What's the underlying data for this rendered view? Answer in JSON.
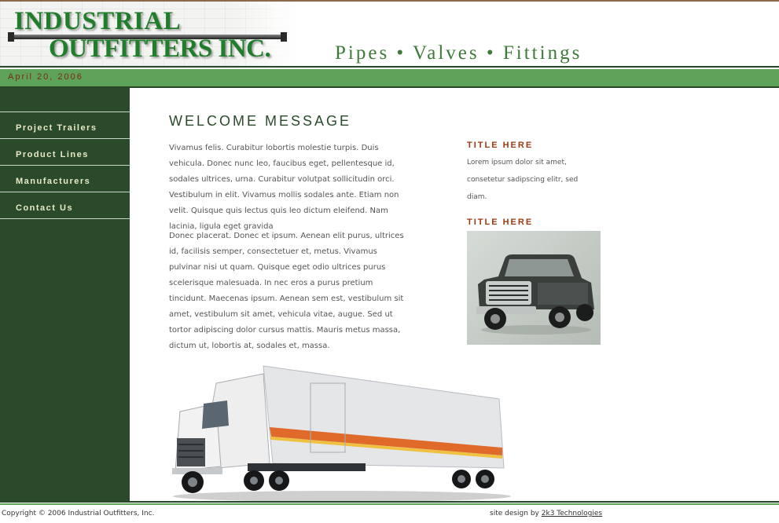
{
  "header": {
    "logo_line1": "INDUSTRIAL",
    "logo_line2": "OUTFITTERS INC.",
    "tagline": "Pipes • Valves • Fittings"
  },
  "date": "April 20, 2006",
  "nav": {
    "items": [
      {
        "label": "Project Trailers"
      },
      {
        "label": "Product Lines"
      },
      {
        "label": "Manufacturers"
      },
      {
        "label": "Contact Us"
      }
    ]
  },
  "main": {
    "heading": "WELCOME MESSAGE",
    "paragraphs": [
      "Vivamus felis. Curabitur lobortis molestie turpis. Duis vehicula. Donec nunc leo, faucibus eget, pellentesque id, sodales ultrices, urna. Curabitur volutpat sollicitudin orci. Vestibulum in elit. Vivamus mollis sodales ante. Etiam non velit. Quisque quis lectus quis leo dictum eleifend. Nam lacinia, ligula eget gravida",
      "Donec placerat. Donec et ipsum. Aenean elit purus, ultrices id, facilisis semper, consectetuer et, metus. Vivamus pulvinar nisi ut quam. Quisque eget odio ultrices purus scelerisque malesuada. In nec eros a purus pretium tincidunt. Maecenas ipsum. Aenean sem est, vestibulum sit amet, vestibulum sit amet, vehicula vitae, augue. Sed ut tortor adipiscing dolor cursus mattis. Mauris metus massa, dictum ut, lobortis at, sodales et, massa."
    ]
  },
  "side": {
    "blocks": [
      {
        "title": "TITLE HERE",
        "text": "Lorem ipsum dolor sit amet, consetetur sadipscing elitr, sed diam."
      },
      {
        "title": "TITLE HERE"
      }
    ]
  },
  "footer": {
    "copyright": "Copyright © 2006 Industrial Outfitters, Inc.",
    "credit_prefix": "site design by",
    "credit_link": "2k3 Technologies"
  },
  "colors": {
    "sidebar_green": "#2b4a2b",
    "accent_green": "#5fa35a",
    "logo_green": "#1f7d2c",
    "title_rust": "#9a3a10"
  }
}
